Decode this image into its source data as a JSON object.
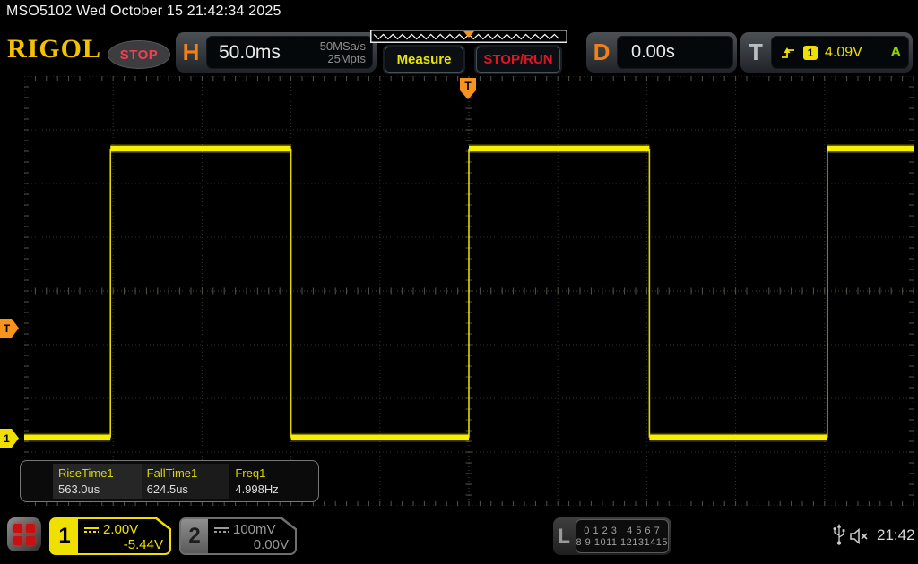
{
  "topbar": {
    "title": "MSO5102  Wed October 15 21:42:34 2025"
  },
  "header": {
    "brand": "RIGOL",
    "acquisition_status": "STOP",
    "horizontal": {
      "label": "H",
      "timebase": "50.0ms",
      "sample_rate": "50MSa/s",
      "memory_depth": "25Mpts"
    },
    "measure_button_label": "Measure",
    "stop_run_button_label": "STOP/RUN",
    "delay": {
      "label": "D",
      "value": "0.00s"
    },
    "trigger": {
      "label": "T",
      "slope_icon": "rising-edge-icon",
      "source_channel": "1",
      "level": "4.09V",
      "mode": "A"
    }
  },
  "plot_markers": {
    "trigger_position_label": "T",
    "trigger_level_label": "T",
    "ch1_offset_label": "1"
  },
  "chart_data": {
    "type": "line",
    "subtype": "square-wave",
    "title": "Oscilloscope CH1 trace",
    "grid": {
      "h_divisions": 10,
      "v_divisions": 8,
      "minor_per_div_x": 8,
      "minor_per_div_y": 5
    },
    "timebase_per_div": "50.0ms",
    "series": [
      {
        "name": "CH1",
        "color": "#f8ee00",
        "volts_per_div": "2.00V",
        "start_level": "low",
        "high_level_div_from_top": 1.35,
        "low_level_div_from_top": 6.73,
        "edge_positions_div": [
          0.97,
          3.0,
          5.0,
          7.03,
          9.03
        ]
      }
    ],
    "trigger": {
      "position_div_x": 5.0,
      "level_div_y": 4.7
    },
    "ch1_offset_div_y": 6.75,
    "period": "200ms",
    "frequency": "4.998Hz"
  },
  "measurements": {
    "items": [
      {
        "label": "RiseTime1",
        "value": "563.0us"
      },
      {
        "label": "FallTime1",
        "value": "624.5us"
      },
      {
        "label": "Freq1",
        "value": "4.998Hz"
      }
    ]
  },
  "channels": {
    "ch1": {
      "number": "1",
      "coupling": "dc-coupling-icon",
      "scale": "2.00V",
      "offset": "-5.44V"
    },
    "ch2": {
      "number": "2",
      "coupling": "dc-coupling-icon",
      "scale": "100mV",
      "offset": "0.00V"
    }
  },
  "digital": {
    "label": "L",
    "row1": "0 1 2 3   4 5 6 7",
    "row2": "8 9 1011 12131415"
  },
  "status": {
    "time": "21:42",
    "usb_icon": "usb-icon",
    "sound_icon": "speaker-muted-icon"
  },
  "colors": {
    "ch1_yellow": "#f0e000",
    "trace_yellow": "#f8ee00",
    "trigger_orange": "#f7931e",
    "accent_orange": "#f08018",
    "run_red": "#e01622",
    "stop_red": "#ef4055",
    "measure_yellow": "#e8e800",
    "mode_green": "#8bd400",
    "brand_gold": "#f2c200"
  }
}
